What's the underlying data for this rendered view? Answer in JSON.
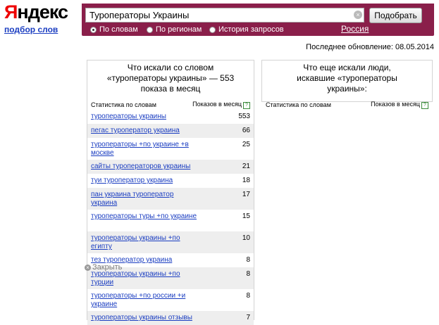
{
  "logo": {
    "first_letter": "Я",
    "rest": "ндекс"
  },
  "service_link": "подбор слов",
  "search": {
    "value": "Туроператоры Украины",
    "clear_icon": "×",
    "submit_label": "Подобрать",
    "modes": [
      {
        "label": "По словам",
        "selected": true
      },
      {
        "label": "По регионам",
        "selected": false
      },
      {
        "label": "История запросов",
        "selected": false
      }
    ],
    "region": "Россия"
  },
  "updated": "Последнее обновление: 08.05.2014",
  "left_panel": {
    "title": "Что искали со словом «туроператоры украины» — 553 показа в месяц",
    "col_phrase": "Статистика по словам",
    "col_count": "Показов в месяц",
    "help_icon": "?",
    "rows": [
      {
        "phrase": "туроператоры украины",
        "count": "553"
      },
      {
        "phrase": "пегас туроператор украина",
        "count": "66"
      },
      {
        "phrase": "туроператоры +по украине +в москве",
        "count": "25"
      },
      {
        "phrase": "сайты туроператоров украины",
        "count": "21"
      },
      {
        "phrase": "туи туроператор украина",
        "count": "18"
      },
      {
        "phrase": "пан украина туроператор украина",
        "count": "17"
      },
      {
        "phrase": "туроператоры туры +по украине",
        "count": "15"
      },
      {
        "phrase": "туроператоры украины +по египту",
        "count": "10"
      },
      {
        "phrase": "тез туроператор украина",
        "count": "8"
      },
      {
        "phrase": "туроператоры украины +по турции",
        "count": "8"
      },
      {
        "phrase": "туроператоры +по россии +и украине",
        "count": "8"
      },
      {
        "phrase": "туроператоры украины отзывы",
        "count": "7"
      }
    ]
  },
  "right_panel": {
    "title": "Что еще искали люди, искавшие «туроператоры украины»:",
    "col_phrase": "Статистика по словам",
    "col_count": "Показов в месяц",
    "help_icon": "?"
  },
  "close_hint": {
    "icon": "×",
    "label": "Закрыть"
  }
}
